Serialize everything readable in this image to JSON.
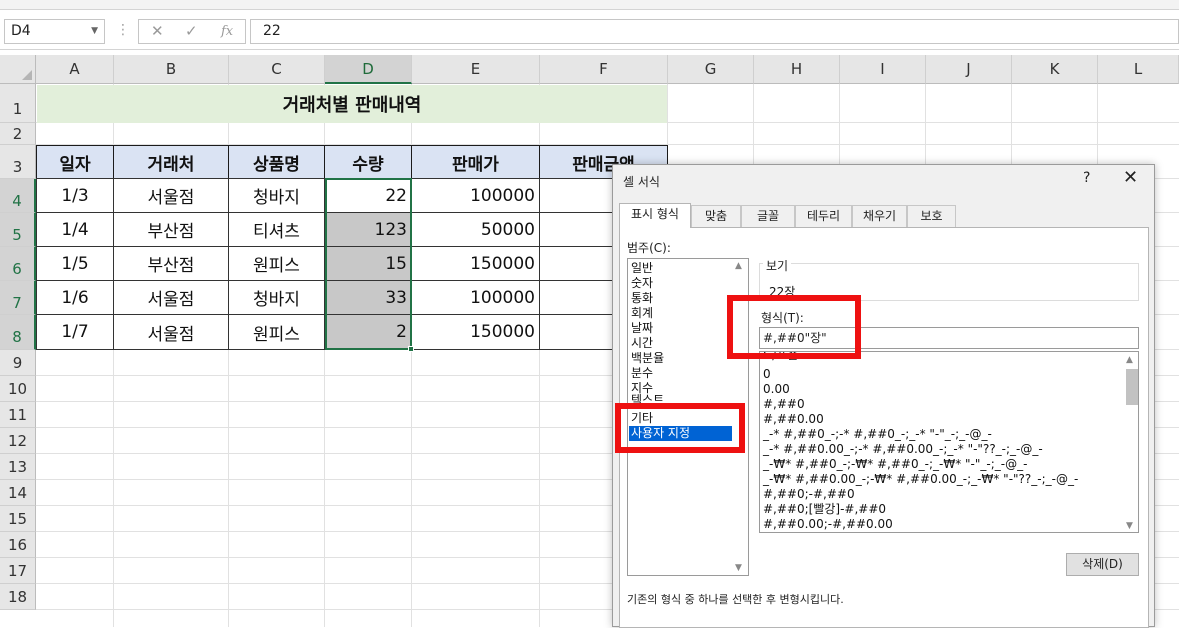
{
  "formula_bar": {
    "name_box": "D4",
    "cancel_glyph": "✕",
    "enter_glyph": "✓",
    "function_glyph": "fx",
    "formula_value": "22"
  },
  "columns": [
    "A",
    "B",
    "C",
    "D",
    "E",
    "F",
    "G",
    "H",
    "I",
    "J",
    "K",
    "L"
  ],
  "rows": [
    "1",
    "2",
    "3",
    "4",
    "5",
    "6",
    "7",
    "8",
    "9",
    "10",
    "11",
    "12",
    "13",
    "14",
    "15",
    "16",
    "17",
    "18"
  ],
  "sheet": {
    "title": "거래처별 판매내역",
    "headers": [
      "일자",
      "거래처",
      "상품명",
      "수량",
      "판매가",
      "판매금액"
    ],
    "data": [
      [
        "1/3",
        "서울점",
        "청바지",
        "22",
        "100000"
      ],
      [
        "1/4",
        "부산점",
        "티셔츠",
        "123",
        "50000"
      ],
      [
        "1/5",
        "부산점",
        "원피스",
        "15",
        "150000"
      ],
      [
        "1/6",
        "서울점",
        "청바지",
        "33",
        "100000"
      ],
      [
        "1/7",
        "서울점",
        "원피스",
        "2",
        "150000"
      ]
    ]
  },
  "dialog": {
    "title": "셀 서식",
    "help": "?",
    "close": "✕",
    "tabs": [
      "표시 형식",
      "맞춤",
      "글꼴",
      "테두리",
      "채우기",
      "보호"
    ],
    "category_label": "범주(C):",
    "categories": [
      "일반",
      "숫자",
      "통화",
      "회계",
      "날짜",
      "시간",
      "백분율",
      "분수",
      "지수",
      "텍스트",
      "기타",
      "사용자 지정"
    ],
    "selected_category": "사용자 지정",
    "sample_label": "보기",
    "sample_value": "22장",
    "type_label": "형식(T):",
    "type_value": "#,##0\"장\"",
    "type_list": [
      "G/표준",
      "0",
      "0.00",
      "#,##0",
      "#,##0.00",
      "_-* #,##0_-;-* #,##0_-;_-* \"-\"_-;_-@_-",
      "_-* #,##0.00_-;-* #,##0.00_-;_-* \"-\"??_-;_-@_-",
      "_-₩* #,##0_-;-₩* #,##0_-;_-₩* \"-\"_-;_-@_-",
      "_-₩* #,##0.00_-;-₩* #,##0.00_-;_-₩* \"-\"??_-;_-@_-",
      "#,##0;-#,##0",
      "#,##0;[빨강]-#,##0",
      "#,##0.00;-#,##0.00"
    ],
    "delete_button": "삭제(D)",
    "description": "기존의 형식 중 하나를 선택한 후 변형시킵니다."
  },
  "colors": {
    "title_band": "#e2efda",
    "header_fill": "#dae3f3",
    "selection": "#217346",
    "highlight": "#ee1111",
    "selected_category": "#0063d4"
  }
}
